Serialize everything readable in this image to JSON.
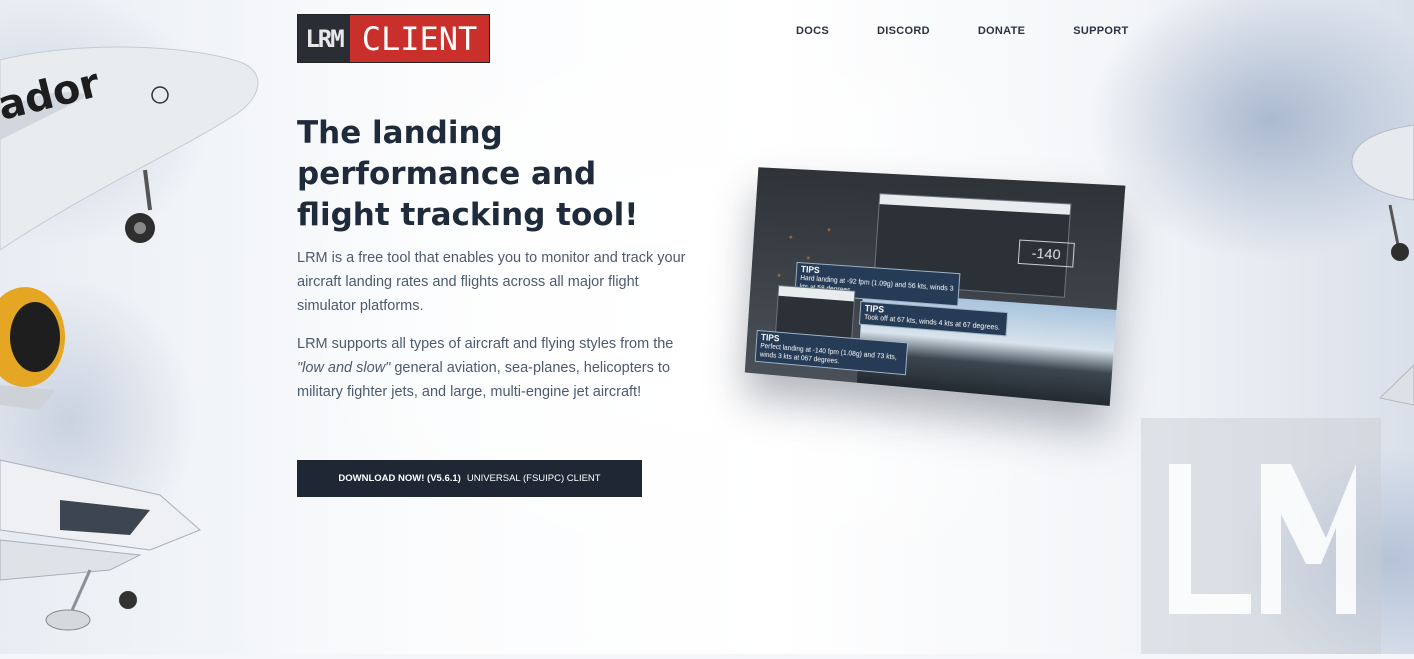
{
  "header": {
    "logo_left": "LRM",
    "logo_right": "CLIENT",
    "nav": [
      "DOCS",
      "DISCORD",
      "DONATE",
      "SUPPORT"
    ]
  },
  "hero": {
    "title": "The landing performance and flight tracking tool!",
    "para1": "LRM is a free tool that enables you to monitor and track your aircraft landing rates and flights across all major flight simulator platforms.",
    "para2_pre": "LRM supports all types of aircraft and flying styles from the ",
    "para2_em": "\"low and slow\"",
    "para2_post": " general aviation, sea-planes, helicopters to military fighter jets, and large, multi-engine jet aircraft!"
  },
  "download": {
    "bold": "DOWNLOAD NOW! (V5.6.1)",
    "rest": "UNIVERSAL (FSUIPC) CLIENT"
  },
  "screenshot": {
    "tip1_title": "TIPS",
    "tip1_text": "Hard landing at -92 fpm (1.09g) and 56 kts, winds 3 kts at 58 degrees.",
    "tip2_title": "TIPS",
    "tip2_text": "Took off at 67 kts, winds 4 kts at 67 degrees.",
    "tip3_title": "TIPS",
    "tip3_text": "Perfect landing at -140 fpm (1.08g) and 73 kts, winds 3 kts at 067 degrees.",
    "readout": "-140"
  },
  "watermark": "LRM",
  "colors": {
    "brand_red": "#c9302c",
    "dark": "#1f2735",
    "text": "#4d5a70"
  }
}
